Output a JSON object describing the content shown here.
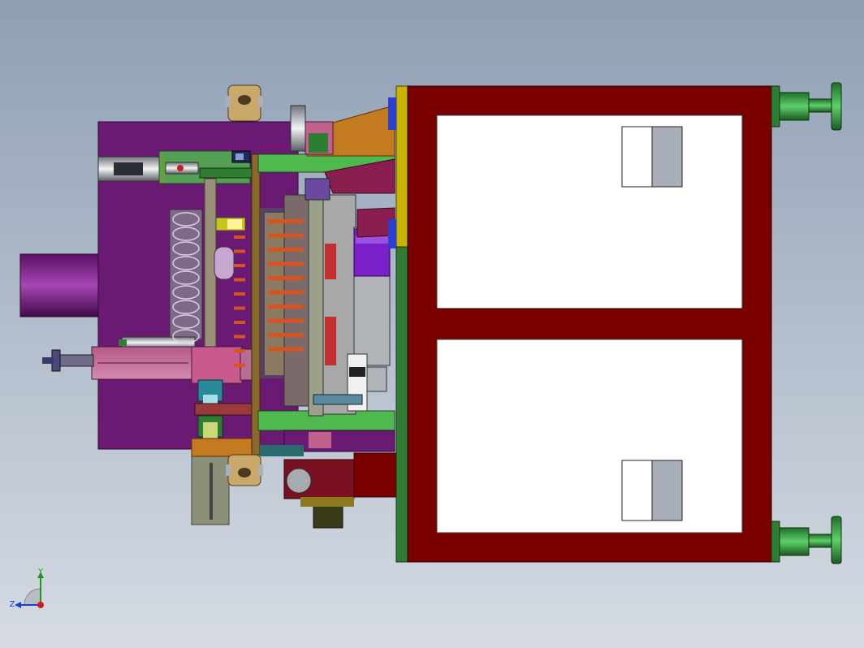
{
  "viewport": {
    "background_top": "#8f9fb4",
    "background_bottom": "#d6dbe3"
  },
  "colors": {
    "frame_red": "#7a0000",
    "plate_purple": "#6a1a72",
    "plate_green": "#4fb84f",
    "dark_green": "#2e7d32",
    "yellow": "#c8b400",
    "orange": "#c47a20",
    "pink": "#c0628c",
    "grey": "#8a8f96",
    "tan": "#c9a86a",
    "olive": "#9aa35a",
    "cylinder_green": "#3aa04a",
    "copper": "#d9531e",
    "blue": "#2a3fcf"
  },
  "triad": {
    "icon": "coordinate-triad-icon",
    "x_label": "",
    "y_label": "Y",
    "z_label": "Z"
  }
}
